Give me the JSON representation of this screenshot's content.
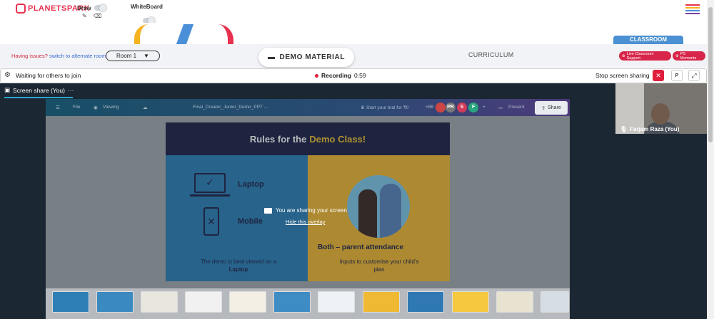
{
  "header": {
    "logo_text": "PLANETSPARK",
    "draw_label": "Draw",
    "whiteboard_label": "WhiteBoard"
  },
  "toolbar": {
    "issues_text": "Having issues?",
    "alternate_link": "switch to alternate room",
    "room_label": "Room 1",
    "demo_material": "DEMO MATERIAL",
    "curriculum": "CURRICULUM",
    "classroom_tab": "CLASSROOM",
    "live_support": "Live Classroom Support",
    "ps_moments": "PS Moments"
  },
  "status": {
    "waiting": "Waiting for others to join",
    "recording_label": "Recording",
    "recording_time": "0:59",
    "stop_sharing": "Stop screen sharing",
    "p_button": "P"
  },
  "screenshare": {
    "tab_label": "Screen share (You)",
    "app_file": "File",
    "app_viewing": "Viewing",
    "app_doc_title": "Final_Creator_Junior_Demo_PPT ...",
    "app_trial": "Start your trial for ₹0",
    "app_count": "+88",
    "app_present": "Present",
    "app_share": "Share",
    "avatars": [
      "PR",
      "S",
      "F"
    ],
    "overlay_msg": "You are sharing your screen",
    "overlay_hide": "Hide this overlay"
  },
  "slide": {
    "title_a": "Rules for the",
    "title_b": "Demo Class!",
    "laptop": "Laptop",
    "mobile": "Mobile",
    "demo_best": "The demo is best viewed on a",
    "demo_best_b": "Laptop",
    "both": "Both – parent attendance",
    "inputs": "Inputs to customise your child's plan"
  },
  "camera": {
    "name": "Farjam Raza (You)"
  },
  "colors": {
    "brand_red": "#e8304f",
    "accent_blue": "#4a90d2",
    "record_red": "#e01e3c",
    "slide_navy": "#1e2347",
    "slide_blue": "#2d7fb5",
    "slide_yellow": "#f0b933"
  }
}
